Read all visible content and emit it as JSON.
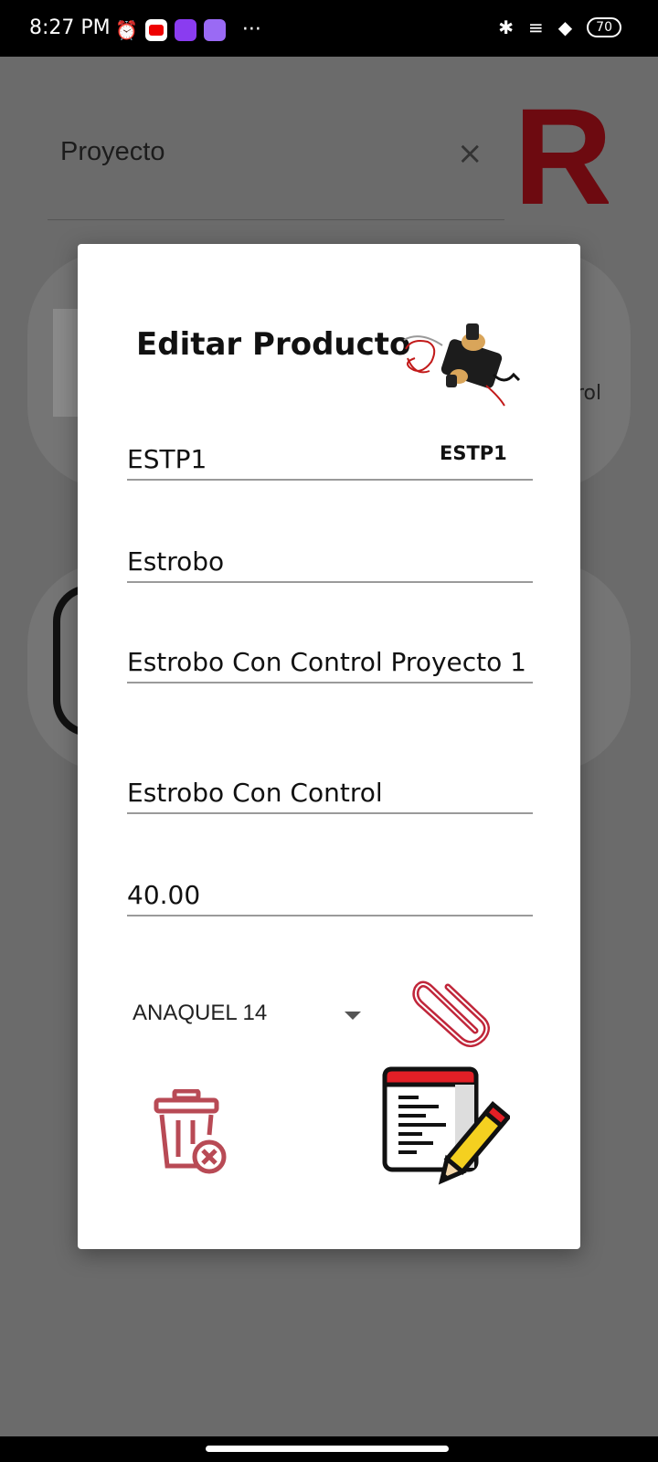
{
  "status_bar": {
    "time": "8:27 PM",
    "battery": "70",
    "icons": [
      "alarm-icon",
      "youtube-icon",
      "twitch-icon",
      "app-icon",
      "more-icon",
      "bluetooth-icon",
      "signal-icon",
      "wifi-icon",
      "battery-icon"
    ]
  },
  "background": {
    "search_value": "Proyecto",
    "clear_icon": "×",
    "logo_letter": "R",
    "card_partial_text": "rol"
  },
  "dialog": {
    "title": "Editar Producto",
    "product_code_label": "ESTP1",
    "fields": {
      "code": "ESTP1",
      "name": "Estrobo",
      "description": "Estrobo Con Control Proyecto 1",
      "short_name": "Estrobo Con Control",
      "price": "40.00"
    },
    "location_select": "ANAQUEL 14",
    "icons": {
      "attach": "paperclip-icon",
      "delete": "trash-delete-icon",
      "edit": "edit-document-icon"
    },
    "colors": {
      "attach": "#c0263a",
      "delete": "#b84a55",
      "edit_header": "#e21f26",
      "pencil": "#f4d020"
    }
  }
}
